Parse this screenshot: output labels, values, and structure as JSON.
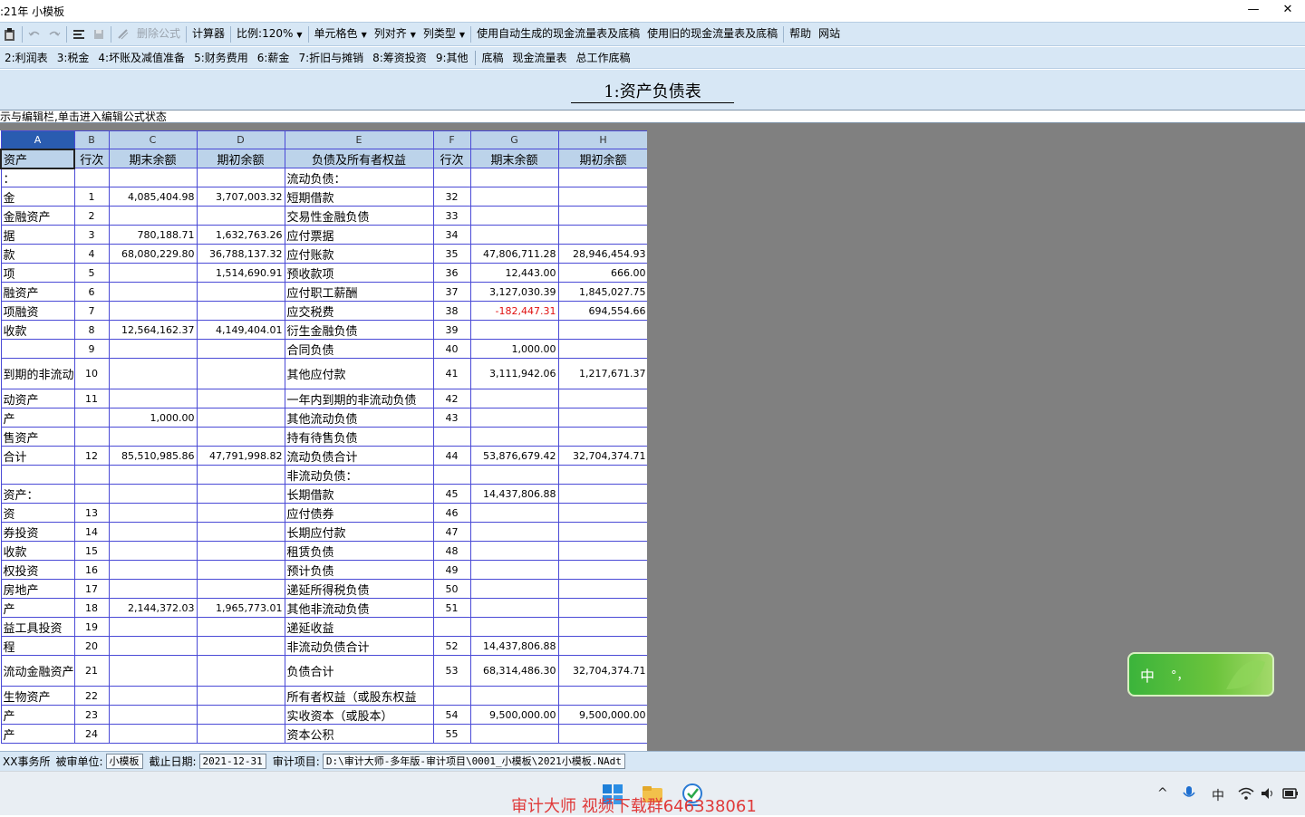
{
  "window": {
    "title": ":21年 小模板",
    "minimize": "—",
    "close": "✕"
  },
  "toolbar": {
    "delete_formula": "删除公式",
    "calculator": "计算器",
    "zoom": "比例:120%",
    "cell_color": "单元格色",
    "column_align": "列对齐",
    "column_type": "列类型",
    "use_auto_cashflow": "使用自动生成的现金流量表及底稿",
    "use_old_cashflow": "使用旧的现金流量表及底稿",
    "help": "帮助",
    "website": "网站"
  },
  "tabs": [
    "2:利润表",
    "3:税金",
    "4:坏账及减值准备",
    "5:财务费用",
    "6:薪金",
    "7:折旧与摊销",
    "8:筹资投资",
    "9:其他",
    "底稿",
    "现金流量表",
    "总工作底稿"
  ],
  "sheet": {
    "title": "1:资产负债表"
  },
  "hint": "示与编辑栏,单击进入编辑公式状态",
  "grid": {
    "col_headers": [
      "A",
      "B",
      "C",
      "D",
      "E",
      "F",
      "G",
      "H"
    ],
    "header_row": [
      "资产",
      "行次",
      "期末余额",
      "期初余额",
      "负债及所有者权益",
      "行次",
      "期末余额",
      "期初余额"
    ],
    "rows": [
      [
        "：",
        "",
        "",
        "",
        "流动负债：",
        "",
        "",
        ""
      ],
      [
        "金",
        "1",
        "4,085,404.98",
        "3,707,003.32",
        "短期借款",
        "32",
        "",
        ""
      ],
      [
        "金融资产",
        "2",
        "",
        "",
        "交易性金融负债",
        "33",
        "",
        ""
      ],
      [
        "据",
        "3",
        "780,188.71",
        "1,632,763.26",
        "应付票据",
        "34",
        "",
        ""
      ],
      [
        "款",
        "4",
        "68,080,229.80",
        "36,788,137.32",
        "应付账款",
        "35",
        "47,806,711.28",
        "28,946,454.93"
      ],
      [
        "项",
        "5",
        "",
        "1,514,690.91",
        "预收款项",
        "36",
        "12,443.00",
        "666.00"
      ],
      [
        "融资产",
        "6",
        "",
        "",
        "应付职工薪酬",
        "37",
        "3,127,030.39",
        "1,845,027.75"
      ],
      [
        "项融资",
        "7",
        "",
        "",
        "应交税费",
        "38",
        "-182,447.31",
        "694,554.66"
      ],
      [
        "收款",
        "8",
        "12,564,162.37",
        "4,149,404.01",
        "衍生金融负债",
        "39",
        "",
        ""
      ],
      [
        "",
        "9",
        "",
        "",
        "合同负债",
        "40",
        "1,000.00",
        ""
      ],
      [
        "到期的非流动",
        "10",
        "",
        "",
        "其他应付款",
        "41",
        "3,111,942.06",
        "1,217,671.37"
      ],
      [
        "动资产",
        "11",
        "",
        "",
        "一年内到期的非流动负债",
        "42",
        "",
        ""
      ],
      [
        "产",
        "",
        "1,000.00",
        "",
        "其他流动负债",
        "43",
        "",
        ""
      ],
      [
        "售资产",
        "",
        "",
        "",
        "持有待售负债",
        "",
        "",
        ""
      ],
      [
        "合计",
        "12",
        "85,510,985.86",
        "47,791,998.82",
        "流动负债合计",
        "44",
        "53,876,679.42",
        "32,704,374.71"
      ],
      [
        "",
        "",
        "",
        "",
        "非流动负债：",
        "",
        "",
        ""
      ],
      [
        "资产：",
        "",
        "",
        "",
        "长期借款",
        "45",
        "14,437,806.88",
        ""
      ],
      [
        "资",
        "13",
        "",
        "",
        "应付债券",
        "46",
        "",
        ""
      ],
      [
        "券投资",
        "14",
        "",
        "",
        "长期应付款",
        "47",
        "",
        ""
      ],
      [
        "收款",
        "15",
        "",
        "",
        "租赁负债",
        "48",
        "",
        ""
      ],
      [
        "权投资",
        "16",
        "",
        "",
        "预计负债",
        "49",
        "",
        ""
      ],
      [
        "房地产",
        "17",
        "",
        "",
        "递延所得税负债",
        "50",
        "",
        ""
      ],
      [
        "产",
        "18",
        "2,144,372.03",
        "1,965,773.01",
        "其他非流动负债",
        "51",
        "",
        ""
      ],
      [
        "益工具投资",
        "19",
        "",
        "",
        "递延收益",
        "",
        "",
        ""
      ],
      [
        "程",
        "20",
        "",
        "",
        "非流动负债合计",
        "52",
        "14,437,806.88",
        ""
      ],
      [
        "流动金融资产",
        "21",
        "",
        "",
        "负债合计",
        "53",
        "68,314,486.30",
        "32,704,374.71"
      ],
      [
        "生物资产",
        "22",
        "",
        "",
        "所有者权益（或股东权益",
        "",
        "",
        ""
      ],
      [
        "产",
        "23",
        "",
        "",
        "实收资本（或股本）",
        "54",
        "9,500,000.00",
        "9,500,000.00"
      ],
      [
        "产",
        "24",
        "",
        "",
        "资本公积",
        "55",
        "",
        ""
      ]
    ]
  },
  "status": {
    "firm": "XX事务所",
    "client_label": "被审单位:",
    "client": "小模板",
    "date_label": "截止日期:",
    "date": "2021-12-31",
    "project_label": "审计项目:",
    "project": "D:\\审计大师-多年版-审计项目\\0001_小模板\\2021小模板.NAdt"
  },
  "taskbar": {
    "watermark": "审计大师  视频下载群646338061",
    "tray_chevron": "^",
    "ime_indicator": "中"
  },
  "ime": {
    "label": "中",
    "punct": "°，"
  }
}
